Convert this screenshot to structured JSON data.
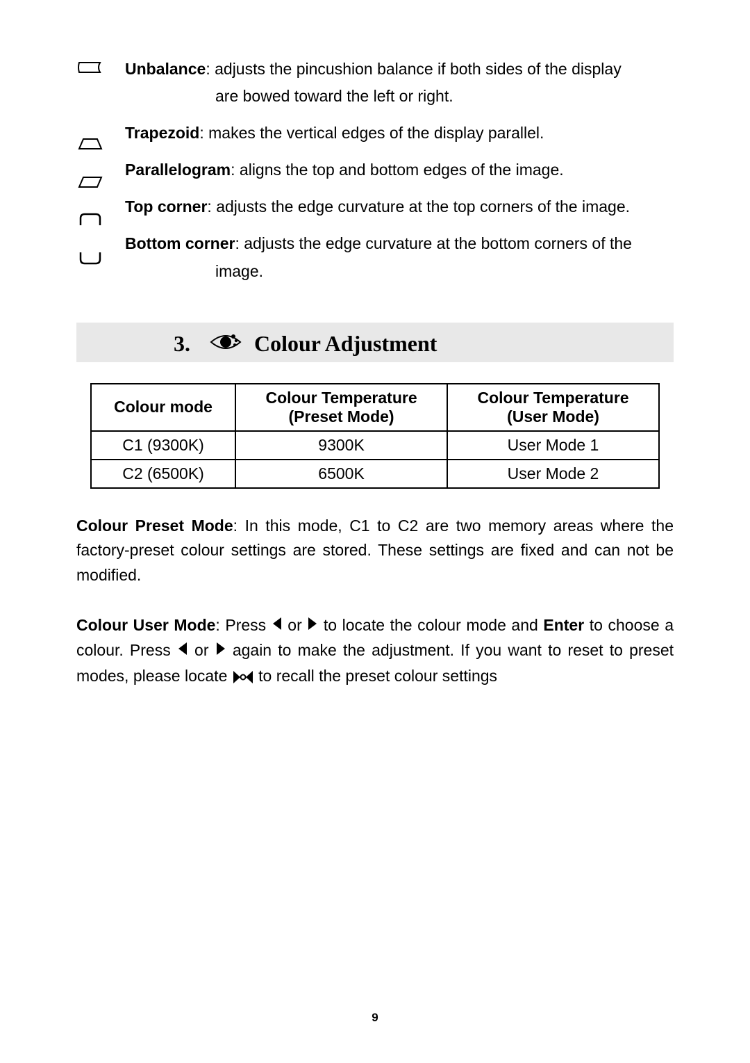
{
  "definitions": {
    "unbalance": {
      "term": "Unbalance",
      "desc": ": adjusts the pincushion balance if both sides of the display",
      "cont": "are bowed toward the left or right."
    },
    "trapezoid": {
      "term": "Trapezoid",
      "desc": ": makes the vertical edges of the display parallel."
    },
    "parallelogram": {
      "term": "Parallelogram",
      "desc": ": aligns the top and bottom edges of the image."
    },
    "top_corner": {
      "term": "Top corner",
      "desc": ": adjusts the edge curvature at the top corners of the image."
    },
    "bottom_corner": {
      "term": "Bottom corner",
      "desc": ": adjusts the edge curvature at the bottom corners of the",
      "cont": "image."
    }
  },
  "section": {
    "number": "3.",
    "title": "Colour Adjustment"
  },
  "table": {
    "headers": {
      "mode": "Colour mode",
      "preset": "Colour Temperature (Preset Mode)",
      "user": "Colour Temperature (User Mode)",
      "preset_l1": "Colour Temperature",
      "preset_l2": "(Preset Mode)",
      "user_l1": "Colour Temperature",
      "user_l2": "(User Mode)"
    },
    "rows": [
      {
        "mode": "C1  (9300K)",
        "preset": "9300K",
        "user": "User Mode 1"
      },
      {
        "mode": "C2  (6500K)",
        "preset": "6500K",
        "user": "User Mode 2"
      }
    ]
  },
  "paragraphs": {
    "preset_mode": {
      "lead": "Colour Preset Mode",
      "body": ": In this mode, C1 to C2 are two memory areas where the factory-preset colour settings are stored.  These settings are fixed and can not be modified."
    },
    "user_mode": {
      "lead": "Colour User Mode",
      "seg1": ": Press ",
      "or1": " or ",
      "seg2": "  to locate the colour mode and ",
      "enter": "Enter",
      "seg3": " to choose a colour.  Press ",
      "or2": " or ",
      "seg4": "  again to make the adjustment.  If you want to reset to preset modes, please locate  ",
      "seg5": "  to recall the preset colour settings"
    }
  },
  "page_number": "9"
}
